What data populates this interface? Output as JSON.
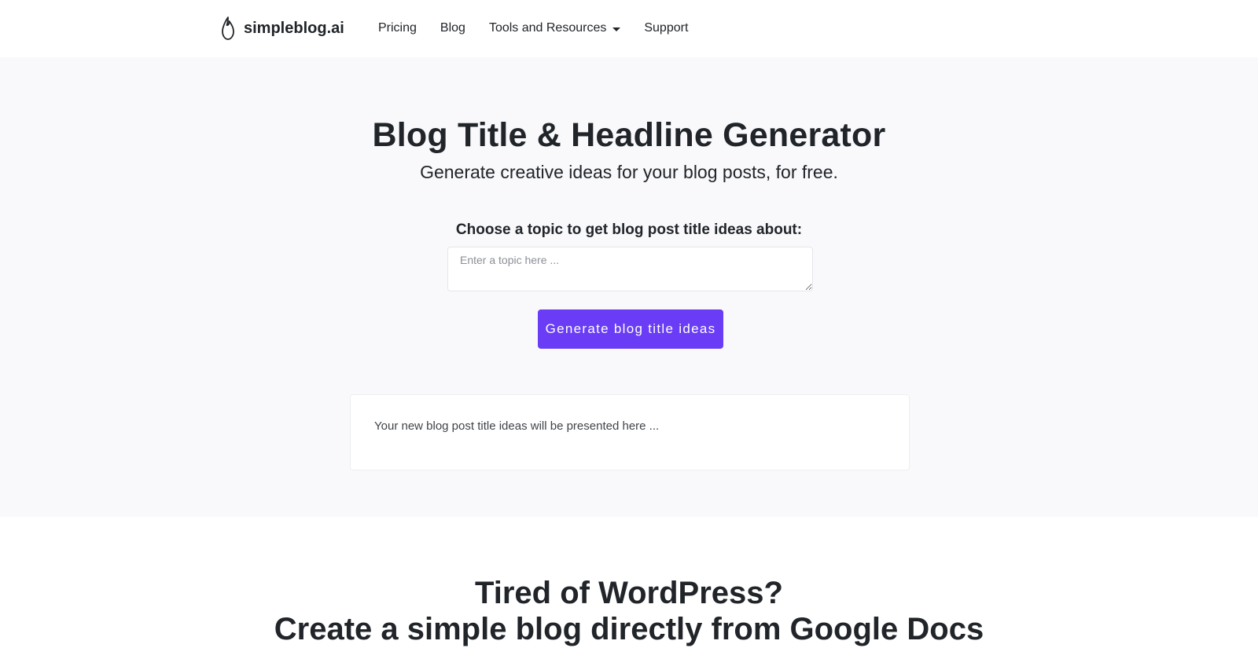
{
  "navbar": {
    "brand_name": "simpleblog.ai",
    "logo_icon": "flame-drop-icon",
    "links": {
      "pricing": "Pricing",
      "blog": "Blog",
      "tools": "Tools and Resources",
      "support": "Support"
    }
  },
  "hero": {
    "title": "Blog Title & Headline Generator",
    "subtitle": "Generate creative ideas for your blog posts, for free.",
    "topic_label": "Choose a topic to get blog post title ideas about:",
    "topic_placeholder": "Enter a topic here ...",
    "topic_value": "",
    "generate_button": "Generate blog title ideas",
    "results_placeholder": "Your new blog post title ideas will be presented here ..."
  },
  "section2": {
    "title": "Tired of WordPress?",
    "subtitle": "Create a simple blog directly from Google Docs"
  },
  "colors": {
    "accent": "#6a3cf6",
    "hero_background": "#f9f9fb",
    "text": "#212529"
  }
}
